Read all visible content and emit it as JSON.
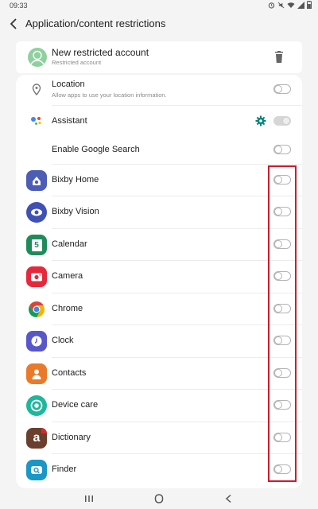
{
  "status_bar": {
    "time": "09:33"
  },
  "header": {
    "title": "Application/content restrictions"
  },
  "account": {
    "name": "New restricted account",
    "subtitle": "Restricted account"
  },
  "settings": {
    "location": {
      "label": "Location",
      "subtitle": "Allow apps to use your location information."
    },
    "assistant": {
      "label": "Assistant"
    },
    "google_search": {
      "label": "Enable Google Search"
    }
  },
  "apps": [
    {
      "label": "Bixby Home",
      "icon": "bixby-home-icon",
      "color": "#4b5db5"
    },
    {
      "label": "Bixby Vision",
      "icon": "bixby-vision-icon",
      "color": "#3f51b5"
    },
    {
      "label": "Calendar",
      "icon": "calendar-icon",
      "color": "#1e8c5a",
      "badge": "5"
    },
    {
      "label": "Camera",
      "icon": "camera-icon",
      "color": "#e6283c"
    },
    {
      "label": "Chrome",
      "icon": "chrome-icon"
    },
    {
      "label": "Clock",
      "icon": "clock-icon",
      "color": "#5757c9"
    },
    {
      "label": "Contacts",
      "icon": "contacts-icon",
      "color": "#ea7a2a"
    },
    {
      "label": "Device care",
      "icon": "device-care-icon",
      "color": "#1db89c"
    },
    {
      "label": "Dictionary",
      "icon": "dictionary-icon",
      "color": "#6a3f2e",
      "badge": "a"
    },
    {
      "label": "Finder",
      "icon": "finder-icon",
      "color": "#1a97c7"
    }
  ],
  "colors": {
    "accent": "#00857a",
    "highlight": "#d11a2a",
    "background": "#f4f4f4"
  }
}
